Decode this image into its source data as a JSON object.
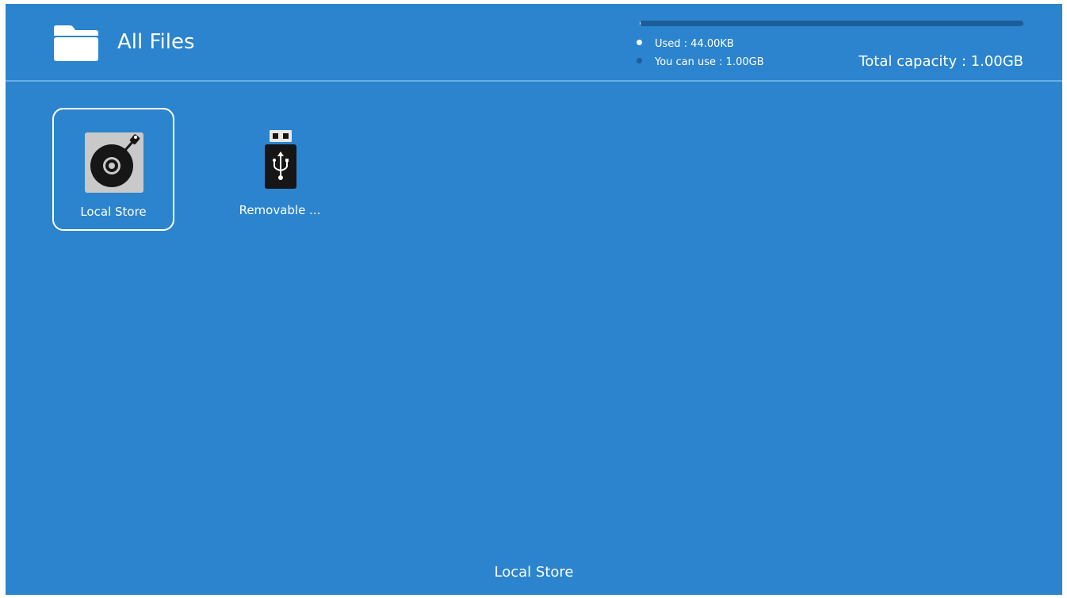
{
  "header": {
    "title": "All Files",
    "title_icon": "folder-icon"
  },
  "storage": {
    "used_fraction": 0.0004,
    "legend": {
      "used": "Used : 44.00KB",
      "free": "You can use : 1.00GB"
    },
    "total_capacity": "Total capacity : 1.00GB",
    "colors": {
      "used": "#ffffff",
      "free": "#1c5e9a"
    }
  },
  "items": [
    {
      "label": "Local Store",
      "icon": "disk-icon",
      "selected": true
    },
    {
      "label": "Removable ...",
      "icon": "usb-drive-icon",
      "selected": false
    }
  ],
  "footer": {
    "current_location": "Local Store"
  },
  "colors": {
    "background": "#2b84cd",
    "text": "#ffffff"
  }
}
